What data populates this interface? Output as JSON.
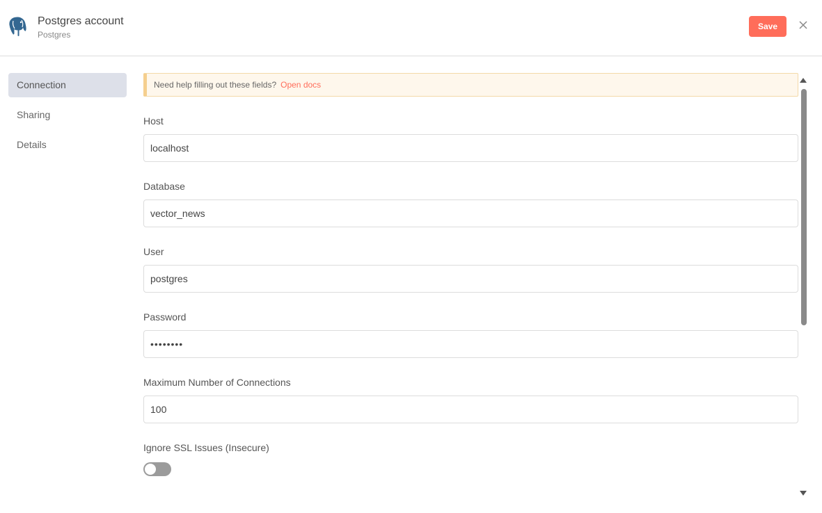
{
  "header": {
    "title": "Postgres account",
    "subtitle": "Postgres",
    "save_label": "Save"
  },
  "sidebar": {
    "items": [
      {
        "label": "Connection"
      },
      {
        "label": "Sharing"
      },
      {
        "label": "Details"
      }
    ]
  },
  "notice": {
    "text": "Need help filling out these fields?",
    "link": "Open docs"
  },
  "fields": {
    "host": {
      "label": "Host",
      "value": "localhost"
    },
    "database": {
      "label": "Database",
      "value": "vector_news"
    },
    "user": {
      "label": "User",
      "value": "postgres"
    },
    "password": {
      "label": "Password",
      "value": "••••••••"
    },
    "max_connections": {
      "label": "Maximum Number of Connections",
      "value": "100"
    },
    "ignore_ssl": {
      "label": "Ignore SSL Issues (Insecure)",
      "enabled": false
    }
  },
  "colors": {
    "accent": "#ff6d5a",
    "active_tab": "#dde0e9"
  }
}
